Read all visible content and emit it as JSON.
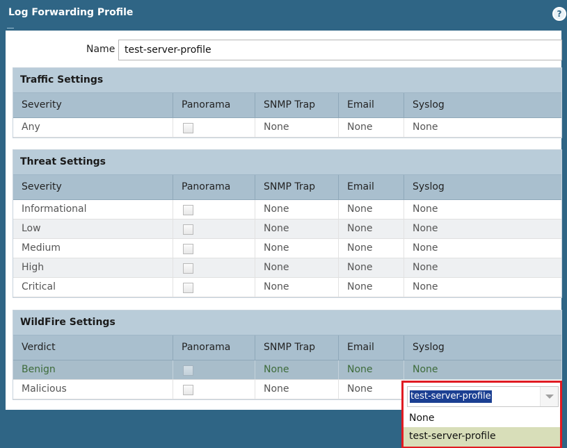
{
  "dialog": {
    "title": "Log Forwarding Profile",
    "help_icon": "?"
  },
  "name": {
    "label": "Name",
    "value": "test-server-profile"
  },
  "traffic": {
    "title": "Traffic Settings",
    "columns": [
      "Severity",
      "Panorama",
      "SNMP Trap",
      "Email",
      "Syslog"
    ],
    "rows": [
      {
        "label": "Any",
        "panorama": false,
        "snmp": "None",
        "email": "None",
        "syslog": "None"
      }
    ]
  },
  "threat": {
    "title": "Threat Settings",
    "columns": [
      "Severity",
      "Panorama",
      "SNMP Trap",
      "Email",
      "Syslog"
    ],
    "rows": [
      {
        "label": "Informational",
        "panorama": false,
        "snmp": "None",
        "email": "None",
        "syslog": "None"
      },
      {
        "label": "Low",
        "panorama": false,
        "snmp": "None",
        "email": "None",
        "syslog": "None"
      },
      {
        "label": "Medium",
        "panorama": false,
        "snmp": "None",
        "email": "None",
        "syslog": "None"
      },
      {
        "label": "High",
        "panorama": false,
        "snmp": "None",
        "email": "None",
        "syslog": "None"
      },
      {
        "label": "Critical",
        "panorama": false,
        "snmp": "None",
        "email": "None",
        "syslog": "None"
      }
    ]
  },
  "wildfire": {
    "title": "WildFire Settings",
    "columns": [
      "Verdict",
      "Panorama",
      "SNMP Trap",
      "Email",
      "Syslog"
    ],
    "rows": [
      {
        "label": "Benign",
        "panorama": false,
        "snmp": "None",
        "email": "None",
        "syslog": "None"
      },
      {
        "label": "Malicious",
        "panorama": false,
        "snmp": "None",
        "email": "None",
        "syslog": ""
      }
    ]
  },
  "syslog_dropdown": {
    "selected": "test-server-profile",
    "options": [
      "None",
      "test-server-profile"
    ]
  },
  "colors": {
    "header": "#2f6585",
    "section_header": "#b9ccd9",
    "column_header": "#a9bfce",
    "highlight_border": "#e01b22",
    "selected_text_bg": "#1b3f92",
    "hover_option": "#d8deb9"
  }
}
